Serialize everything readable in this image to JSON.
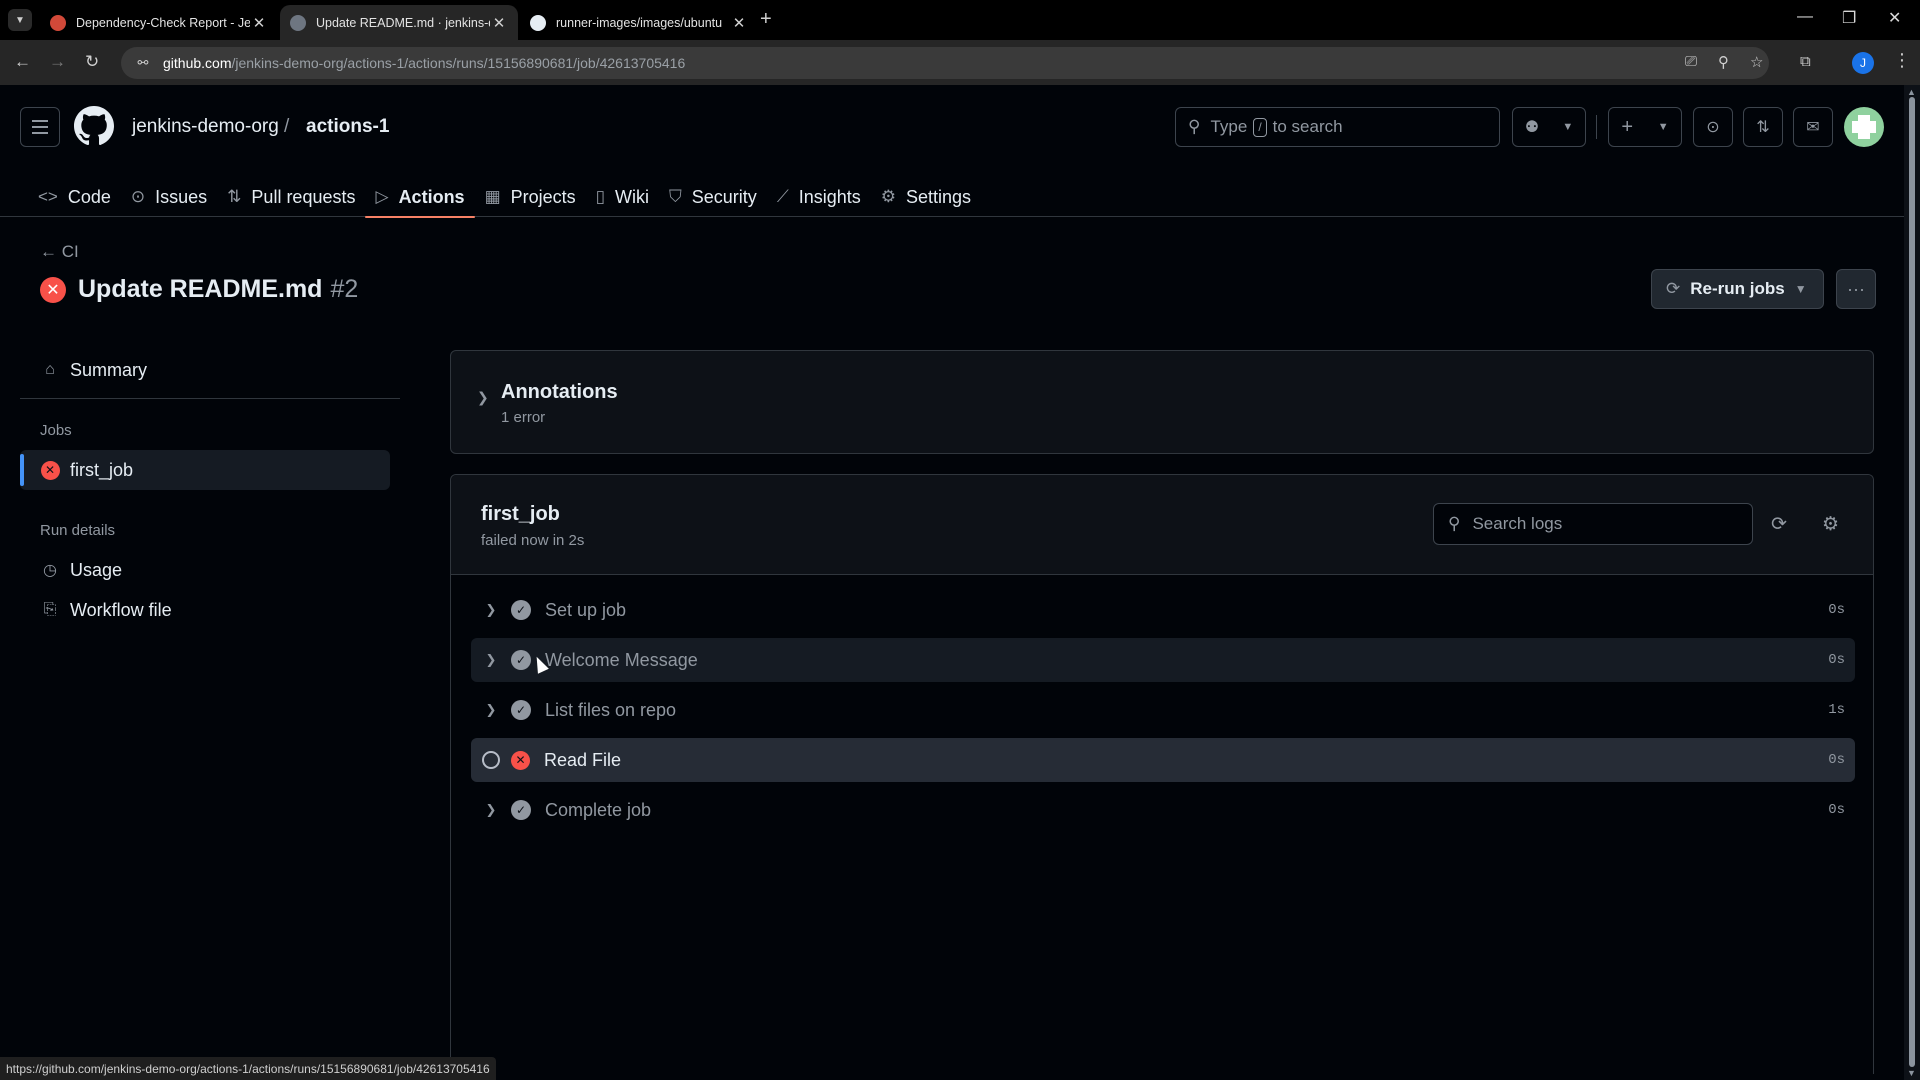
{
  "browser": {
    "tabs": [
      {
        "title": "Dependency-Check Report - Je",
        "active": false
      },
      {
        "title": "Update README.md · jenkins-d",
        "active": true
      },
      {
        "title": "runner-images/images/ubuntu",
        "active": false
      }
    ],
    "url_host": "github.com",
    "url_path": "/jenkins-demo-org/actions-1/actions/runs/15156890681/job/42613705416",
    "profile_initial": "J",
    "status_url": "https://github.com/jenkins-demo-org/actions-1/actions/runs/15156890681/job/42613705416"
  },
  "header": {
    "owner": "jenkins-demo-org",
    "separator": "/",
    "repo": "actions-1",
    "search_prefix": "Type",
    "search_key": "/",
    "search_suffix": "to search"
  },
  "repo_nav": [
    {
      "label": "Code",
      "icon": "code-icon",
      "glyph": "<>"
    },
    {
      "label": "Issues",
      "icon": "issue-icon",
      "glyph": "⊙"
    },
    {
      "label": "Pull requests",
      "icon": "pull-request-icon",
      "glyph": "⇅"
    },
    {
      "label": "Actions",
      "icon": "play-icon",
      "glyph": "▷"
    },
    {
      "label": "Projects",
      "icon": "table-icon",
      "glyph": "▦"
    },
    {
      "label": "Wiki",
      "icon": "book-icon",
      "glyph": "▯"
    },
    {
      "label": "Security",
      "icon": "shield-icon",
      "glyph": "⛉"
    },
    {
      "label": "Insights",
      "icon": "graph-icon",
      "glyph": "⟋"
    },
    {
      "label": "Settings",
      "icon": "gear-icon",
      "glyph": "⚙"
    }
  ],
  "run": {
    "back_label": "CI",
    "title": "Update README.md",
    "number": "#2",
    "rerun_label": "Re-run jobs"
  },
  "sidebar": {
    "summary": "Summary",
    "jobs_heading": "Jobs",
    "job": "first_job",
    "run_details_heading": "Run details",
    "usage": "Usage",
    "workflow_file": "Workflow file"
  },
  "annotations": {
    "title": "Annotations",
    "subtitle": "1 error"
  },
  "job": {
    "name": "first_job",
    "status": "failed now in 2s",
    "search_placeholder": "Search logs",
    "steps": [
      {
        "name": "Set up job",
        "duration": "0s",
        "status": "success"
      },
      {
        "name": "Welcome Message",
        "duration": "0s",
        "status": "success"
      },
      {
        "name": "List files on repo",
        "duration": "1s",
        "status": "success"
      },
      {
        "name": "Read File",
        "duration": "0s",
        "status": "failure"
      },
      {
        "name": "Complete job",
        "duration": "0s",
        "status": "success"
      }
    ]
  },
  "colors": {
    "accent_blue": "#4493f8",
    "failure_red": "#f85149",
    "tab_underline": "#f78166"
  }
}
